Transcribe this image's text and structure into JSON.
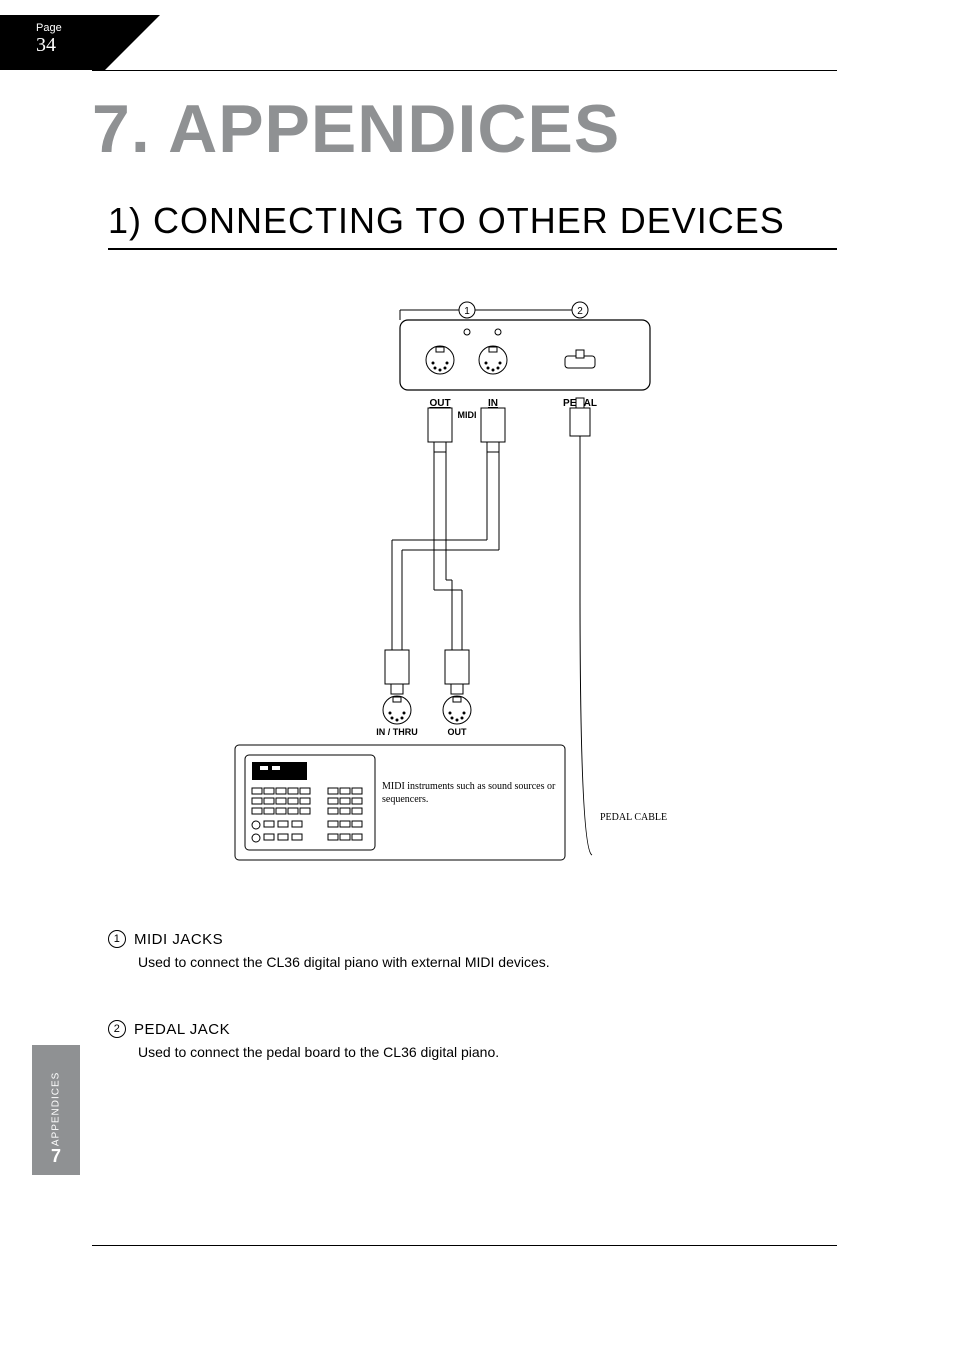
{
  "page": {
    "label": "Page",
    "number": "34"
  },
  "title": "7. APPENDICES",
  "section_title": "1) CONNECTING TO OTHER DEVICES",
  "diagram": {
    "callouts": {
      "c1": "1",
      "c2": "2"
    },
    "top_panel": {
      "out": "OUT",
      "in": "IN",
      "midi": "MIDI",
      "pedal": "PEDAL"
    },
    "bottom_panel": {
      "in_thru": "IN / THRU",
      "out": "OUT"
    },
    "device_note": "MIDI instruments such as sound sources or sequencers.",
    "pedal_cable": "PEDAL CABLE"
  },
  "items": [
    {
      "num": "1",
      "heading": "MIDI JACKS",
      "body": "Used to connect the CL36 digital piano with external MIDI devices."
    },
    {
      "num": "2",
      "heading": "PEDAL JACK",
      "body": "Used to connect the pedal board to the CL36 digital piano."
    }
  ],
  "side": {
    "chapter_num": "7",
    "chapter_label": "APPENDICES"
  }
}
